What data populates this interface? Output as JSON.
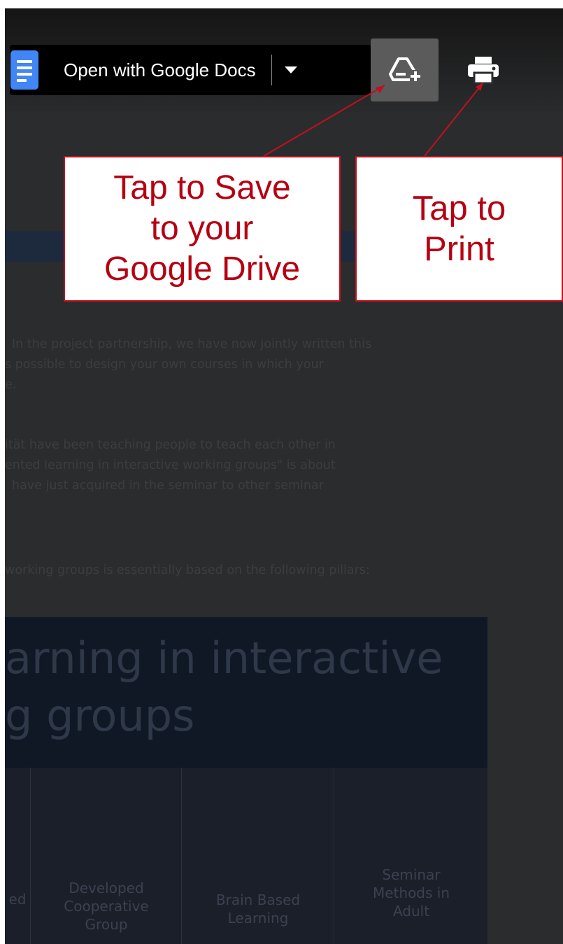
{
  "toolbar": {
    "open_with_label": "Open with Google Docs",
    "docs_icon": "google-docs-icon",
    "dropdown_icon": "caret-down-icon",
    "save_drive_icon": "drive-add-icon",
    "print_icon": "printer-icon"
  },
  "callouts": {
    "save": [
      "Tap to Save",
      "to your",
      "Google Drive"
    ],
    "print": [
      "Tap to",
      "Print"
    ]
  },
  "document": {
    "paragraph1": [
      "In the project partnership, we have now jointly written this",
      "s possible to design your own courses in which your",
      "e."
    ],
    "paragraph2": [
      "ität have been teaching people to teach each other in",
      "ented learning in interactive working groups\" is about",
      "have just acquired in the seminar to other seminar"
    ],
    "paragraph3": "working groups is essentially based on the following pillars:",
    "banner": [
      "arning in interactive",
      "g groups"
    ],
    "pillars": [
      [
        "ed"
      ],
      [
        "Developed",
        "Cooperative",
        "Group"
      ],
      [
        "Brain Based",
        "Learning"
      ],
      [
        "Seminar",
        "Methods in",
        "Adult"
      ]
    ]
  },
  "colors": {
    "accent_red": "#c2101e",
    "docs_blue": "#4285f4",
    "overlay": "#2a2b2d"
  }
}
